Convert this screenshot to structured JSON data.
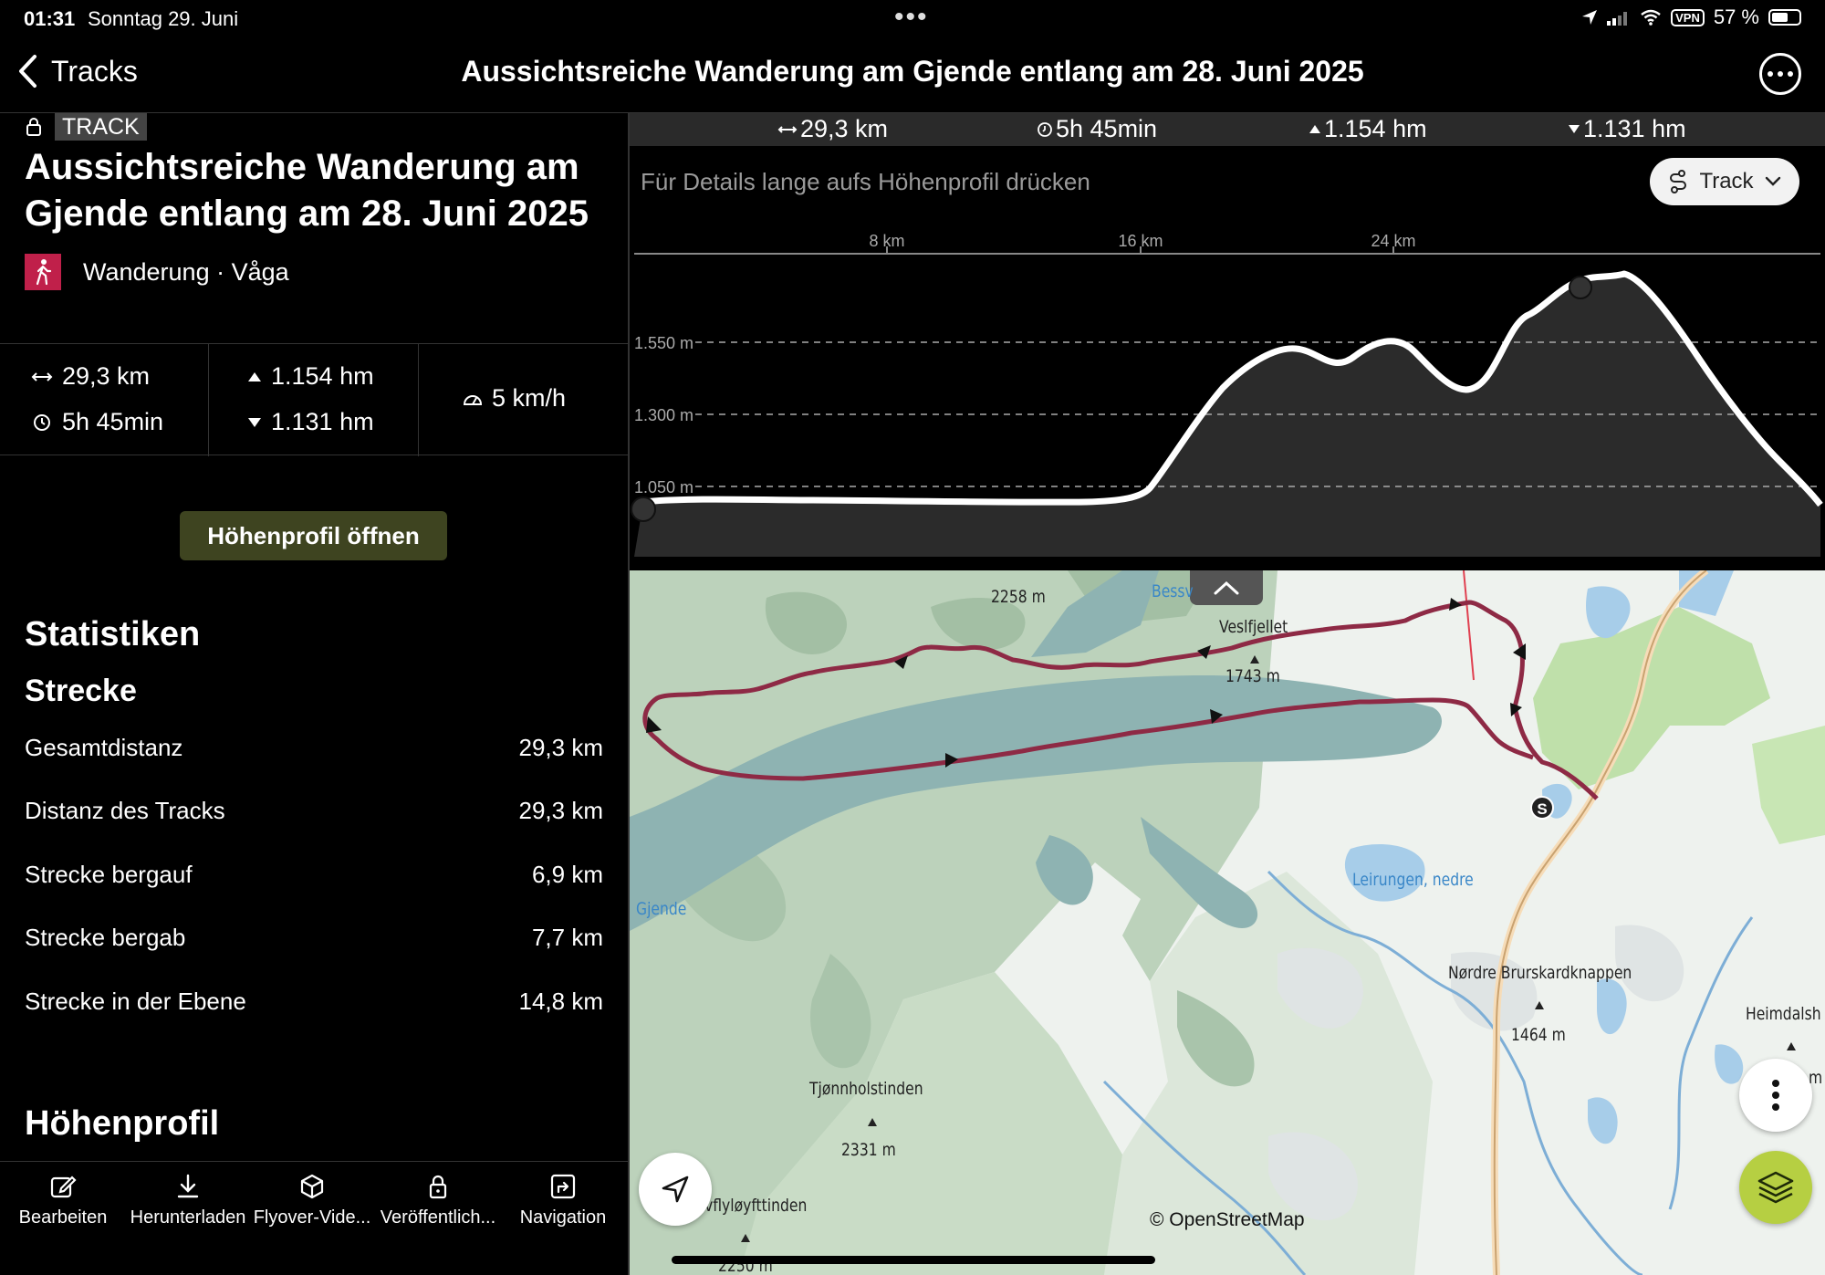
{
  "status_bar": {
    "time": "01:31",
    "date": "Sonntag 29. Juni",
    "vpn": "VPN",
    "battery": "57 %"
  },
  "nav": {
    "back_label": "Tracks",
    "title": "Aussichtsreiche Wanderung am Gjende entlang am 28. Juni 2025"
  },
  "track": {
    "tag": "TRACK",
    "title": "Aussichtsreiche Wanderung am Gjende entlang am 28. Juni 2025",
    "activity": "Wanderung · Våga",
    "activity_color": "#c0204a"
  },
  "summary": {
    "distance": "29,3 km",
    "duration": "5h 45min",
    "ascent": "1.154 hm",
    "descent": "1.131 hm",
    "speed": "5 km/h"
  },
  "open_profile_button": "Höhenprofil öffnen",
  "statistics": {
    "title": "Statistiken",
    "section": "Strecke",
    "rows": [
      {
        "label": "Gesamtdistanz",
        "value": "29,3 km"
      },
      {
        "label": "Distanz des Tracks",
        "value": "29,3 km"
      },
      {
        "label": "Strecke bergauf",
        "value": "6,9 km"
      },
      {
        "label": "Strecke bergab",
        "value": "7,7 km"
      },
      {
        "label": "Strecke in der Ebene",
        "value": "14,8 km"
      }
    ],
    "next_section": "Höhenprofil"
  },
  "toolbar": [
    {
      "label": "Bearbeiten",
      "icon": "edit-icon"
    },
    {
      "label": "Herunterladen",
      "icon": "download-icon"
    },
    {
      "label": "Flyover-Vide...",
      "icon": "cube-icon"
    },
    {
      "label": "Veröffentlich...",
      "icon": "lock-icon"
    },
    {
      "label": "Navigation",
      "icon": "navigation-icon"
    }
  ],
  "elevation_header": {
    "distance": "29,3 km",
    "duration": "5h 45min",
    "ascent": "1.154 hm",
    "descent": "1.131 hm"
  },
  "elevation": {
    "hint": "Für Details lange aufs Höhenprofil drücken",
    "selector": "Track",
    "x_ticks": [
      "8 km",
      "16 km",
      "24 km"
    ],
    "y_ticks": [
      "1.550 m",
      "1.300 m",
      "1.050 m"
    ],
    "accent": "#3e4420"
  },
  "map": {
    "labels": {
      "peak_2258": "2258 m",
      "bessv": "Bessv",
      "veslfjellet": "Veslfjellet",
      "peak_1743": "1743 m",
      "gjende": "Gjende",
      "leirungen": "Leirungen, nedre",
      "nordre": "Nørdre Brurskardknappen",
      "peak_1464": "1464 m",
      "heimdalsh": "Heimdalsh",
      "m_suffix": "m",
      "tjonnholstinden": "Tjønnholstinden",
      "peak_2331": "2331 m",
      "flyloyfttinden": "vflyløyfttinden",
      "peak_2250": "2250 m"
    },
    "start_marker": "S",
    "attribution": "© OpenStreetMap",
    "track_color": "#8e2a45"
  }
}
